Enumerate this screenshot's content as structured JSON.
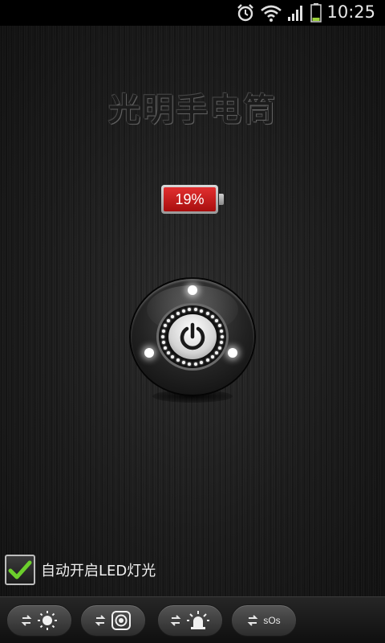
{
  "status_bar": {
    "time": "10:25",
    "icons": [
      "alarm-icon",
      "wifi-icon",
      "signal-icon",
      "battery-icon"
    ]
  },
  "app": {
    "title": "光明手电筒"
  },
  "battery": {
    "percent_text": "19%",
    "level": 0.19,
    "color": "#d61f1f"
  },
  "power_button": {
    "icon": "power-icon"
  },
  "auto_led": {
    "label": "自动开启LED灯光",
    "checked": true,
    "check_color": "#6ccf2c"
  },
  "bottom_bar": {
    "buttons": [
      {
        "icon": "light-icon"
      },
      {
        "icon": "camera-flash-icon"
      },
      {
        "icon": "siren-icon"
      },
      {
        "icon": "sos-icon",
        "label": "sOs"
      }
    ]
  }
}
